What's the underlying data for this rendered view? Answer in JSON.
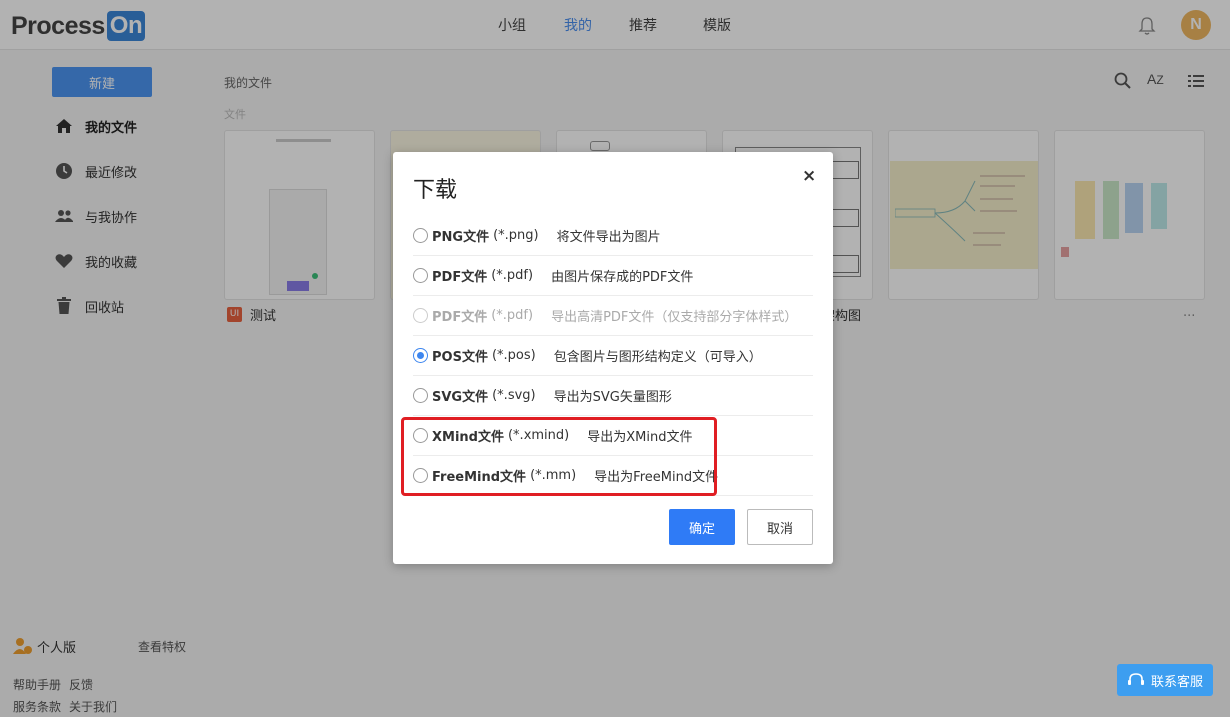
{
  "app": {
    "logo_main": "Process",
    "logo_accent": "On"
  },
  "nav": {
    "items": [
      "小组",
      "我的",
      "推荐",
      "模版"
    ],
    "active": "我的"
  },
  "user": {
    "avatar_letter": "N"
  },
  "sidebar": {
    "new_label": "新建",
    "items": [
      {
        "label": "我的文件",
        "icon": "home-icon"
      },
      {
        "label": "最近修改",
        "icon": "clock-icon"
      },
      {
        "label": "与我协作",
        "icon": "people-icon"
      },
      {
        "label": "我的收藏",
        "icon": "heart-icon"
      },
      {
        "label": "回收站",
        "icon": "trash-icon"
      }
    ],
    "plan_label": "个人版",
    "plan_link": "查看特权",
    "footer_links": [
      "帮助手册",
      "反馈",
      "服务条款",
      "关于我们"
    ]
  },
  "main": {
    "breadcrumb": "我的文件",
    "section_label": "文件",
    "cards": [
      {
        "title": "测试"
      },
      {
        "title": ""
      },
      {
        "title": ""
      },
      {
        "title": "架构图"
      },
      {
        "title": ""
      },
      {
        "title": "..."
      }
    ]
  },
  "dialog": {
    "title": "下载",
    "close_label": "×",
    "options": [
      {
        "name": "PNG文件",
        "ext": "(*.png)",
        "desc": "将文件导出为图片",
        "checked": false,
        "disabled": false
      },
      {
        "name": "PDF文件",
        "ext": "(*.pdf)",
        "desc": "由图片保存成的PDF文件",
        "checked": false,
        "disabled": false
      },
      {
        "name": "PDF文件",
        "ext": "(*.pdf)",
        "desc": "导出高清PDF文件（仅支持部分字体样式）",
        "checked": false,
        "disabled": true
      },
      {
        "name": "POS文件",
        "ext": "(*.pos)",
        "desc": "包含图片与图形结构定义（可导入）",
        "checked": true,
        "disabled": false
      },
      {
        "name": "SVG文件",
        "ext": "(*.svg)",
        "desc": "导出为SVG矢量图形",
        "checked": false,
        "disabled": false
      },
      {
        "name": "XMind文件",
        "ext": "(*.xmind)",
        "desc": "导出为XMind文件",
        "checked": false,
        "disabled": false
      },
      {
        "name": "FreeMind文件",
        "ext": "(*.mm)",
        "desc": "导出为FreeMind文件",
        "checked": false,
        "disabled": false
      }
    ],
    "ok_label": "确定",
    "cancel_label": "取消"
  },
  "support": {
    "label": "联系客服"
  },
  "colors": {
    "accent": "#2f7bf6",
    "highlight": "#e01e23",
    "avatar": "#f0b862"
  }
}
